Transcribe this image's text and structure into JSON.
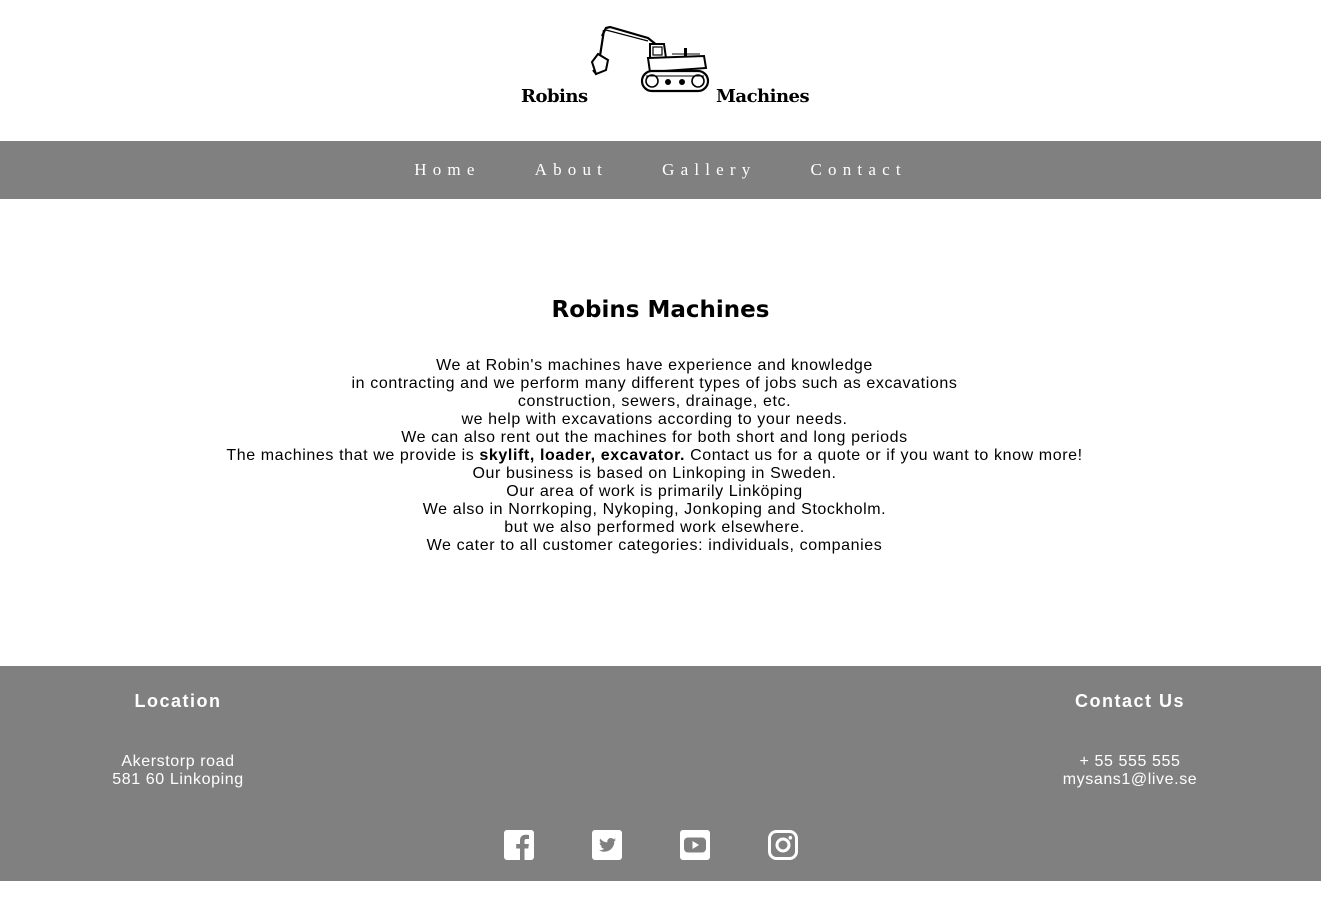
{
  "logo": {
    "left_word": "Robins",
    "right_word": "Machines"
  },
  "nav": {
    "items": [
      {
        "label": "Home"
      },
      {
        "label": "About"
      },
      {
        "label": "Gallery"
      },
      {
        "label": "Contact"
      }
    ]
  },
  "main": {
    "title": "Robins Machines",
    "lines": [
      "We at Robin's machines have experience and knowledge",
      "in contracting and we perform many different types of jobs such as excavations",
      "construction, sewers, drainage, etc.",
      "we help with excavations according to your needs.",
      "We can also rent out the machines for both short and long periods"
    ],
    "machines_line": {
      "prefix": "The machines that we provide is ",
      "bold": "skylift, loader, excavator.",
      "suffix": " Contact us for a quote or if you want to know more!"
    },
    "lines_after": [
      "Our business is based on Linkoping in Sweden.",
      "Our area of work is primarily Linköping",
      "We also in Norrkoping, Nykoping, Jonkoping and Stockholm.",
      "but we also performed work elsewhere.",
      "We cater to all customer categories: individuals, companies"
    ]
  },
  "footer": {
    "location": {
      "heading": "Location",
      "address_line1": "Akerstorp road",
      "address_line2": "581 60 Linkoping"
    },
    "contact": {
      "heading": "Contact Us",
      "phone": "+ 55 555 555",
      "email": "mysans1@live.se"
    },
    "social": [
      {
        "icon": "facebook-icon"
      },
      {
        "icon": "twitter-icon"
      },
      {
        "icon": "youtube-icon"
      },
      {
        "icon": "instagram-icon"
      }
    ]
  },
  "colors": {
    "nav_background": "#808080",
    "footer_background": "#808080",
    "text_light": "#ffffff"
  }
}
